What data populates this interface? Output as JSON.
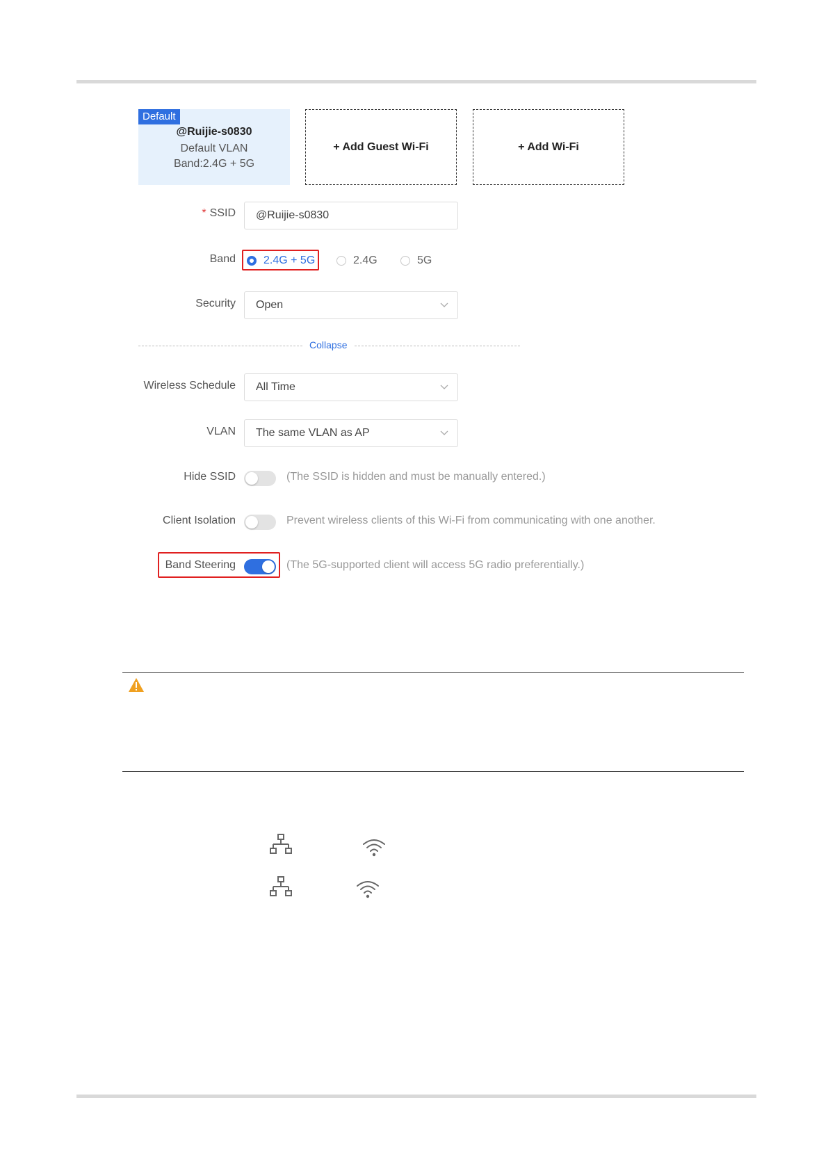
{
  "cards": {
    "default_badge": "Default",
    "default_ssid": "@Ruijie-s0830",
    "default_vlan": "Default VLAN",
    "default_band": "Band:2.4G + 5G",
    "add_guest": "+ Add Guest Wi-Fi",
    "add_wifi": "+ Add Wi-Fi"
  },
  "form": {
    "ssid_required": "*",
    "ssid_label": "SSID",
    "ssid_value": "@Ruijie-s0830",
    "band_label": "Band",
    "band_options": [
      "2.4G + 5G",
      "2.4G",
      "5G"
    ],
    "band_selected": "2.4G + 5G",
    "security_label": "Security",
    "security_value": "Open",
    "collapse": "Collapse",
    "schedule_label": "Wireless Schedule",
    "schedule_value": "All Time",
    "vlan_label": "VLAN",
    "vlan_value": "The same VLAN as AP",
    "hide_ssid_label": "Hide SSID",
    "hide_ssid_on": false,
    "hide_ssid_hint": "(The SSID is hidden and must be manually entered.)",
    "isolation_label": "Client Isolation",
    "isolation_on": false,
    "isolation_hint": "Prevent wireless clients of this Wi-Fi from communicating with one another.",
    "steering_label": "Band Steering",
    "steering_on": true,
    "steering_hint": "(The 5G-supported client will access 5G radio preferentially.)"
  },
  "colors": {
    "accent": "#2f6fe0",
    "highlight": "#e02020",
    "warning": "#f0a020"
  },
  "icons": [
    "warning-icon",
    "network-topology-icon",
    "wifi-icon"
  ]
}
